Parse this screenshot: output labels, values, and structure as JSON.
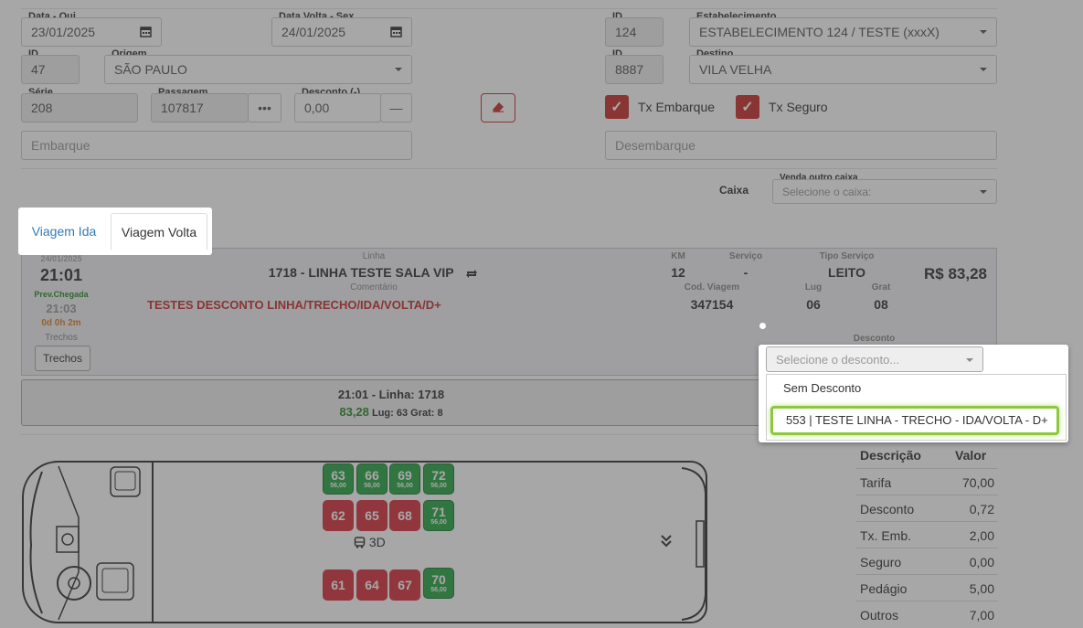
{
  "form": {
    "data_ida_label": "Data - Qui",
    "data_ida_value": "23/01/2025",
    "data_volta_label": "Data Volta - Sex",
    "data_volta_value": "24/01/2025",
    "estab_id_label": "ID",
    "estab_id_value": "124",
    "estab_label": "Estabelecimento",
    "estab_value": "ESTABELECIMENTO 124 / TESTE (xxxX)",
    "origem_id_label": "ID",
    "origem_id_value": "47",
    "origem_label": "Origem",
    "origem_value": "SÃO PAULO",
    "destino_id_label": "ID",
    "destino_id_value": "8887",
    "destino_label": "Destino",
    "destino_value": "VILA VELHA",
    "serie_label": "Série",
    "serie_value": "208",
    "passagem_label": "Passagem",
    "passagem_value": "107817",
    "passagem_btn": "•••",
    "desconto_label": "Desconto (-)",
    "desconto_value": "0,00",
    "desconto_btn": "—",
    "tx_embarque_label": "Tx Embarque",
    "tx_seguro_label": "Tx Seguro",
    "embarque_placeholder": "Embarque",
    "desembarque_placeholder": "Desembarque",
    "caixa_label": "Caixa",
    "venda_outro_caixa_label": "Venda outro caixa",
    "venda_outro_caixa_placeholder": "Selecione o caixa:"
  },
  "tabs": [
    {
      "label": "Viagem Ida",
      "active": false
    },
    {
      "label": "Viagem Volta",
      "active": true
    }
  ],
  "trip": {
    "date": "24/01/2025",
    "time": "21:01",
    "prev_chegada_label": "Prev.Chegada",
    "arrival_time": "21:03",
    "duration": "0d 0h 2m",
    "trechos_label": "Trechos",
    "trechos_button": "Trechos",
    "linha_label": "Linha",
    "linha_value": "1718 - LINHA TESTE SALA VIP",
    "comentario_label": "Comentário",
    "comentario_value": "TESTES DESCONTO LINHA/TRECHO/IDA/VOLTA/D+",
    "km_label": "KM",
    "km_value": "12",
    "servico_label": "Serviço",
    "servico_value": "-",
    "tipo_servico_label": "Tipo Serviço",
    "tipo_servico_value": "LEITO",
    "price": "R$ 83,28",
    "cod_viagem_label": "Cod. Viagem",
    "cod_viagem_value": "347154",
    "lug_label": "Lug",
    "lug_value": "06",
    "grat_label": "Grat",
    "grat_value": "08",
    "desconto_label": "Desconto"
  },
  "summary": {
    "line": "21:01 - Linha: 1718",
    "price": "83,28",
    "lug": "Lug: 63",
    "grat": "Grat: 8"
  },
  "dropdown": {
    "placeholder": "Selecione o desconto...",
    "options": [
      "Sem Desconto",
      "553 | TESTE LINHA - TRECHO - IDA/VOLTA - D+"
    ],
    "highlighted_index": 1
  },
  "bus": {
    "label_3d": "3D",
    "seats": [
      {
        "num": "63",
        "price": "56,00",
        "status": "available"
      },
      {
        "num": "66",
        "price": "56,00",
        "status": "available"
      },
      {
        "num": "69",
        "price": "56,00",
        "status": "available"
      },
      {
        "num": "72",
        "price": "56,00",
        "status": "available"
      },
      {
        "num": "62",
        "price": "",
        "status": "occupied"
      },
      {
        "num": "65",
        "price": "",
        "status": "occupied"
      },
      {
        "num": "68",
        "price": "",
        "status": "occupied"
      },
      {
        "num": "71",
        "price": "56,00",
        "status": "available"
      },
      {
        "num": "61",
        "price": "",
        "status": "occupied"
      },
      {
        "num": "64",
        "price": "",
        "status": "occupied"
      },
      {
        "num": "67",
        "price": "",
        "status": "occupied"
      },
      {
        "num": "70",
        "price": "56,00",
        "status": "available"
      }
    ]
  },
  "fares": {
    "header_desc": "Descrição",
    "header_valor": "Valor",
    "rows": [
      {
        "desc": "Tarifa",
        "valor": "70,00"
      },
      {
        "desc": "Desconto",
        "valor": "0,72"
      },
      {
        "desc": "Tx. Emb.",
        "valor": "2,00"
      },
      {
        "desc": "Seguro",
        "valor": "0,00"
      },
      {
        "desc": "Pedágio",
        "valor": "5,00"
      },
      {
        "desc": "Outros",
        "valor": "7,00"
      }
    ]
  },
  "colors": {
    "accent_red": "#c9302c",
    "seat_green": "#28a745",
    "seat_red": "#d9323f",
    "highlight_green": "#8dc63f",
    "link_blue": "#337ab7"
  }
}
